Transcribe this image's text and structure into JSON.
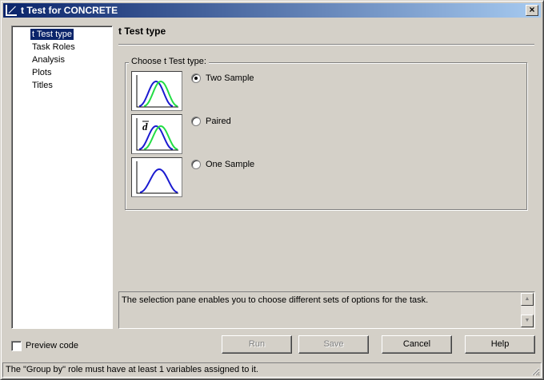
{
  "window": {
    "title": "t Test for CONCRETE",
    "close_glyph": "×"
  },
  "nav": {
    "items": [
      {
        "label": "t Test type",
        "selected": true
      },
      {
        "label": "Task Roles"
      },
      {
        "label": "Analysis"
      },
      {
        "label": "Plots"
      },
      {
        "label": "Titles"
      }
    ]
  },
  "main": {
    "title": "t Test type",
    "group_label": "Choose t Test type:",
    "options": [
      {
        "label": "Two Sample",
        "checked": true,
        "icon": "two-sample-distribution-icon"
      },
      {
        "label": "Paired",
        "checked": false,
        "icon": "paired-distribution-icon"
      },
      {
        "label": "One Sample",
        "checked": false,
        "icon": "one-sample-distribution-icon"
      }
    ],
    "paired_symbol": "d"
  },
  "description": "The selection pane enables you to choose different sets of options for the task.",
  "footer": {
    "preview_label": "Preview code",
    "preview_checked": false,
    "buttons": {
      "run": "Run",
      "save": "Save",
      "cancel": "Cancel",
      "help": "Help"
    }
  },
  "status": "The \"Group by\" role must have at least 1 variables assigned to it.",
  "colors": {
    "title_bar": "#0a246a",
    "curve_blue": "#1a1ad0",
    "curve_green": "#22dd44"
  }
}
